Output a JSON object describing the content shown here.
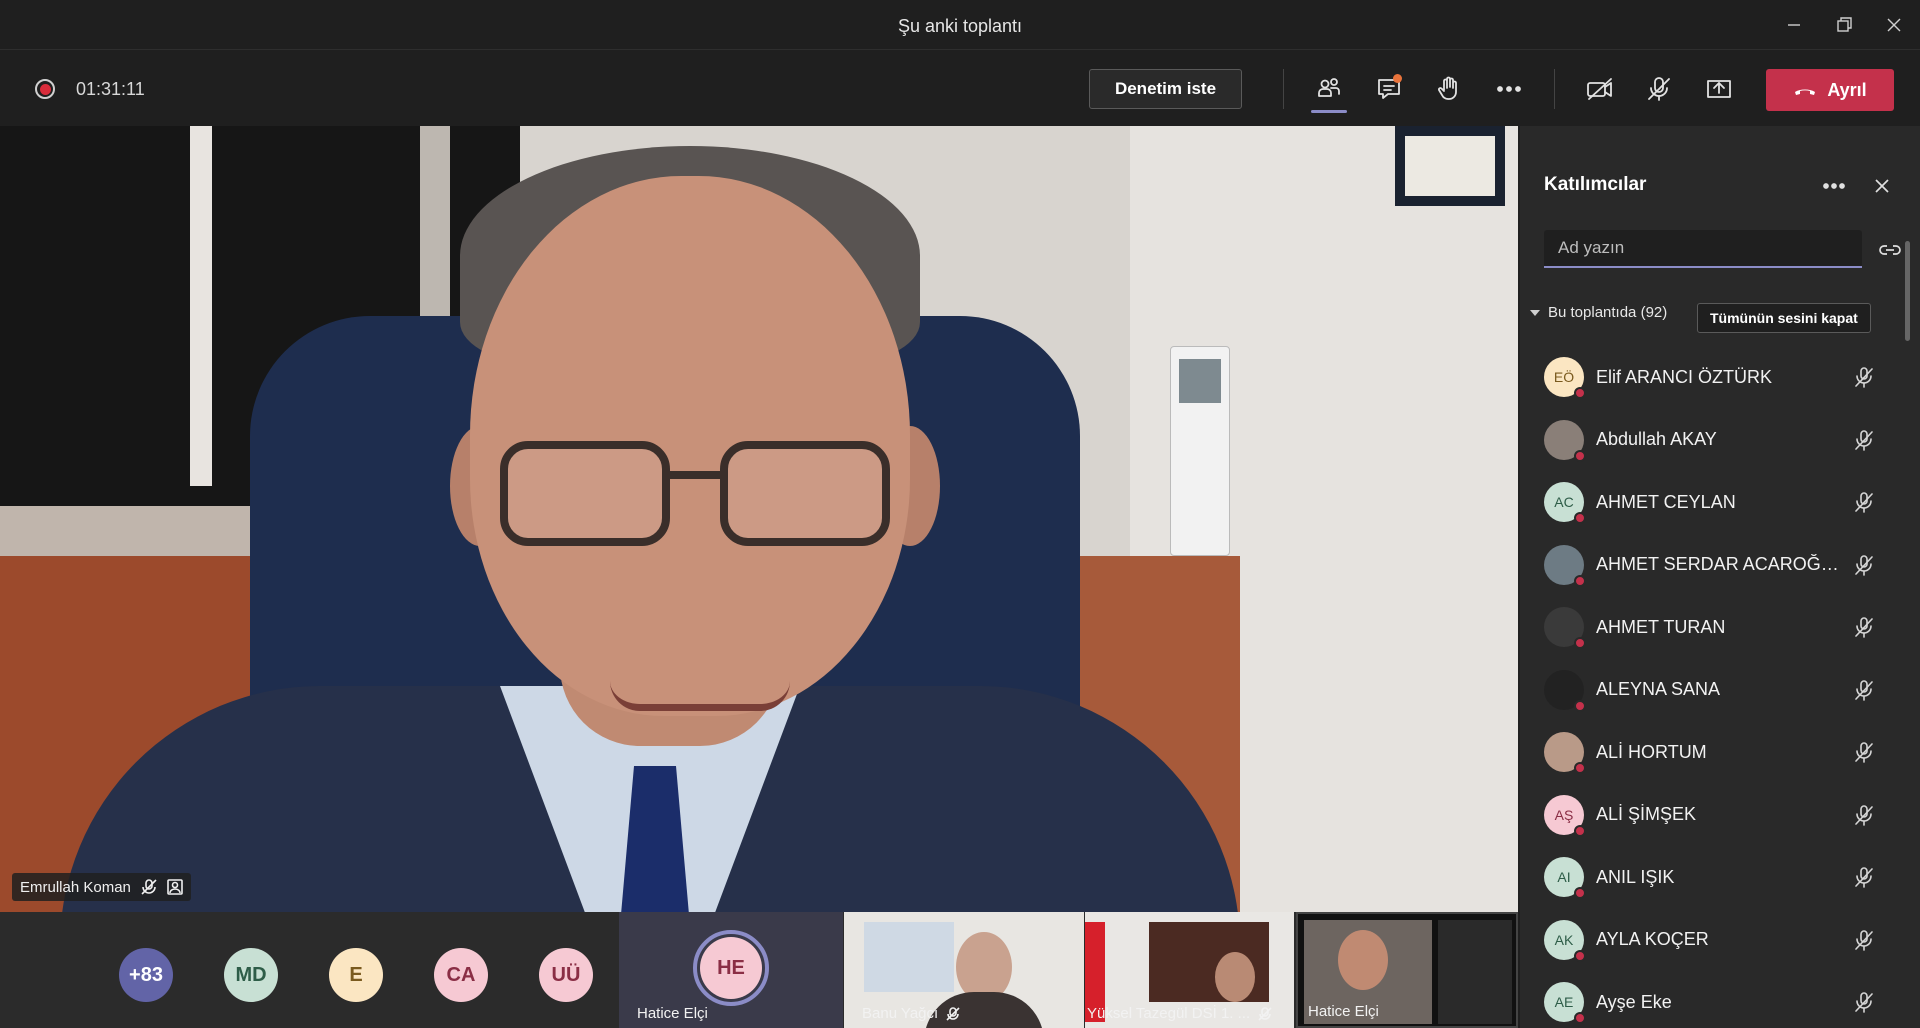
{
  "window": {
    "title": "Şu anki toplantı"
  },
  "toolbar": {
    "timer": "01:31:11",
    "control_label": "Denetim iste",
    "leave_label": "Ayrıl"
  },
  "stage": {
    "speaker_name": "Emrullah Koman"
  },
  "strip": {
    "overflow": "+83",
    "avatars": [
      {
        "initials": "MD",
        "bg": "#c8e0d4",
        "fg": "#2e5d48"
      },
      {
        "initials": "E",
        "bg": "#fbe6c2",
        "fg": "#7a5a1e"
      },
      {
        "initials": "CA",
        "bg": "#f6c9d3",
        "fg": "#8a2e45"
      },
      {
        "initials": "UÜ",
        "bg": "#f6c9d3",
        "fg": "#8a2e45"
      }
    ],
    "tiles": [
      {
        "name": "Hatice Elçi",
        "initials": "HE"
      },
      {
        "name": "Banu Yağcı"
      },
      {
        "name": "Yüksel Tazegül DSİ 1. ..."
      },
      {
        "name": "Hatice Elçi"
      }
    ]
  },
  "panel": {
    "title": "Katılımcılar",
    "search_placeholder": "Ad yazın",
    "section": "Bu toplantıda (92)",
    "mute_all": "Tümünün sesini kapat",
    "participants": [
      {
        "name": "Elif ARANCI ÖZTÜRK",
        "initials": "EÖ",
        "bg": "#fbe6c2",
        "fg": "#7a5a1e"
      },
      {
        "name": "Abdullah AKAY",
        "initials": "",
        "bg": "#8a7f78",
        "fg": "#fff"
      },
      {
        "name": "AHMET CEYLAN",
        "initials": "AC",
        "bg": "#c8e0d4",
        "fg": "#2e5d48"
      },
      {
        "name": "AHMET SERDAR ACAROĞULL...",
        "initials": "",
        "bg": "#6d7b84",
        "fg": "#fff"
      },
      {
        "name": "AHMET TURAN",
        "initials": "",
        "bg": "#3a3a3a",
        "fg": "#fff"
      },
      {
        "name": "ALEYNA SANA",
        "initials": "",
        "bg": "#222",
        "fg": "#fff"
      },
      {
        "name": "ALİ HORTUM",
        "initials": "",
        "bg": "#b99a88",
        "fg": "#fff"
      },
      {
        "name": "ALİ ŞİMŞEK",
        "initials": "AŞ",
        "bg": "#f6c9d3",
        "fg": "#8a2e45"
      },
      {
        "name": "ANIL IŞIK",
        "initials": "AI",
        "bg": "#c8e0d4",
        "fg": "#2e5d48"
      },
      {
        "name": "AYLA KOÇER",
        "initials": "AK",
        "bg": "#c8e0d4",
        "fg": "#2e5d48"
      },
      {
        "name": "Ayşe Eke",
        "initials": "AE",
        "bg": "#c8e0d4",
        "fg": "#2e5d48"
      }
    ]
  },
  "colors": {
    "accent": "#8b8cc7",
    "leave": "#c4314b",
    "recording": "#d92c3b"
  }
}
